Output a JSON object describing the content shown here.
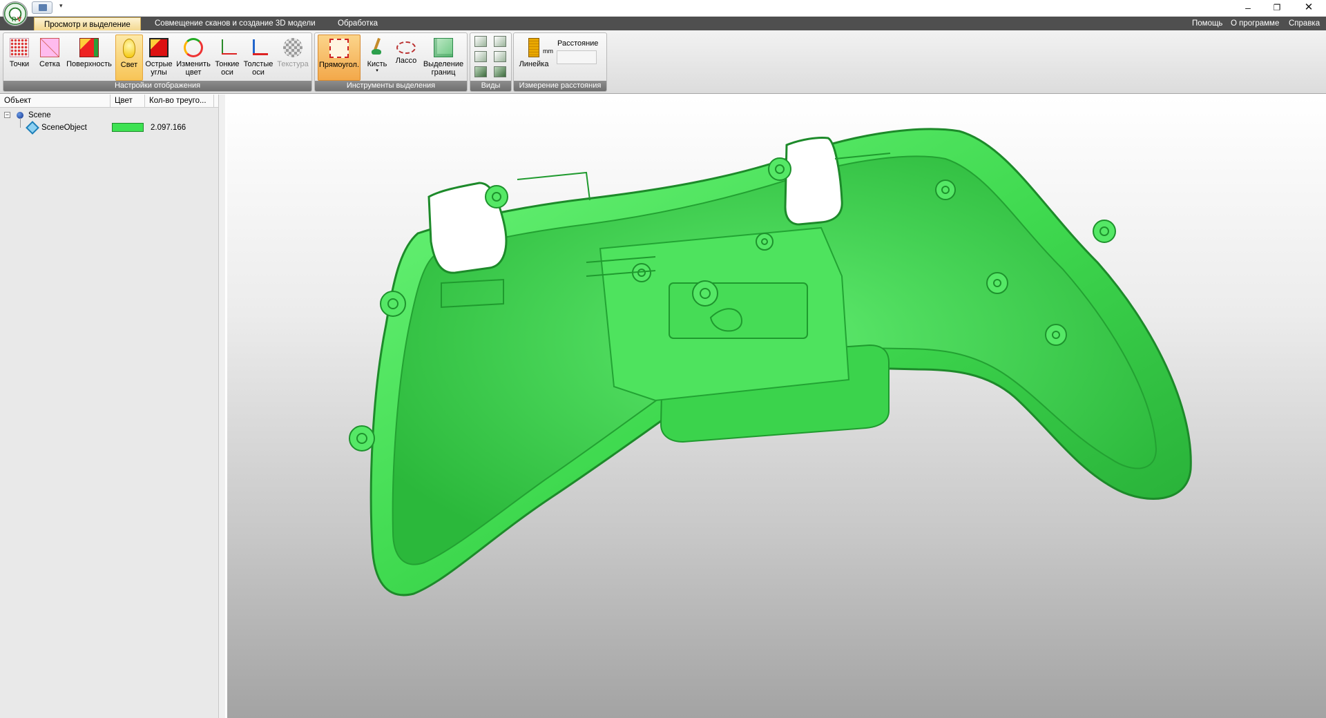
{
  "titlebar": {
    "window_buttons": {
      "minimize": "–",
      "maximize": "❐",
      "close": "✕"
    },
    "quick_access": {
      "dropdown": "▾"
    },
    "logo": {
      "letters_r": "R",
      "letters_v": "V"
    }
  },
  "tabs": {
    "view_select": "Просмотр и выделение",
    "align": "Совмещение сканов и создание 3D модели",
    "processing": "Обработка"
  },
  "top_menu": {
    "help": "Помощь",
    "about": "О программе",
    "reference": "Справка"
  },
  "ribbon": {
    "display": {
      "label": "Настройки отображения",
      "points": "Точки",
      "mesh": "Сетка",
      "surface": "Поверхность",
      "light": "Свет",
      "sharp_edges": "Острые\nуглы",
      "change_color": "Изменить\nцвет",
      "thin_axes": "Тонкие\nоси",
      "thick_axes": "Толстые\nоси",
      "texture": "Текстура"
    },
    "selection": {
      "label": "Инструменты выделения",
      "rectangle": "Прямоугол.",
      "brush": "Кисть",
      "lasso": "Лассо",
      "boundary": "Выделение\nграниц",
      "dropdown": "▾"
    },
    "views": {
      "label": "Виды"
    },
    "measure": {
      "label": "Измерение расстояния",
      "ruler": "Линейка",
      "ruler_unit": "mm",
      "distance_label": "Расстояние",
      "distance_value": ""
    }
  },
  "tree": {
    "columns": [
      "Объект",
      "Цвет",
      "Кол-во треуго..."
    ],
    "rows": [
      {
        "name": "Scene",
        "expander": "−",
        "count": ""
      },
      {
        "name": "SceneObject",
        "count": "2.097.166",
        "color": "#3de252"
      }
    ]
  },
  "viewport": {
    "model_color": "#3fd94f"
  }
}
